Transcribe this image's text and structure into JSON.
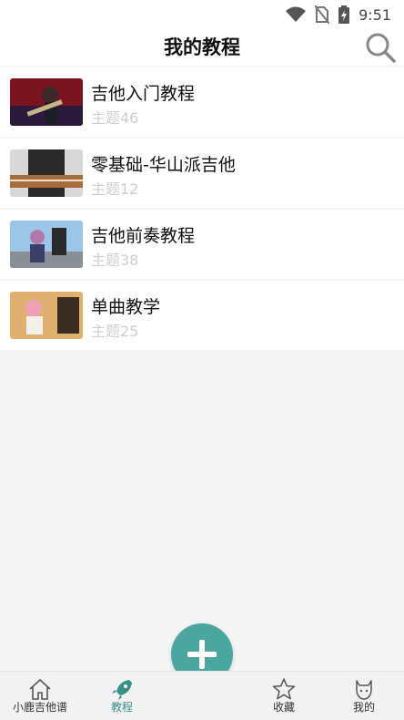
{
  "status": {
    "time": "9:51"
  },
  "header": {
    "title": "我的教程"
  },
  "list": [
    {
      "title": "吉他入门教程",
      "subtitle": "主题46"
    },
    {
      "title": "零基础-华山派吉他",
      "subtitle": "主题12"
    },
    {
      "title": "吉他前奏教程",
      "subtitle": "主题38"
    },
    {
      "title": "单曲教学",
      "subtitle": "主题25"
    }
  ],
  "tabs": [
    {
      "label": "小鹿吉他谱",
      "icon": "home-icon"
    },
    {
      "label": "教程",
      "icon": "rocket-icon",
      "active": true
    },
    {
      "label": "收藏",
      "icon": "star-icon"
    },
    {
      "label": "我的",
      "icon": "cat-icon"
    }
  ],
  "colors": {
    "accent": "#4aa69e",
    "active_tab": "#3a8f88"
  }
}
